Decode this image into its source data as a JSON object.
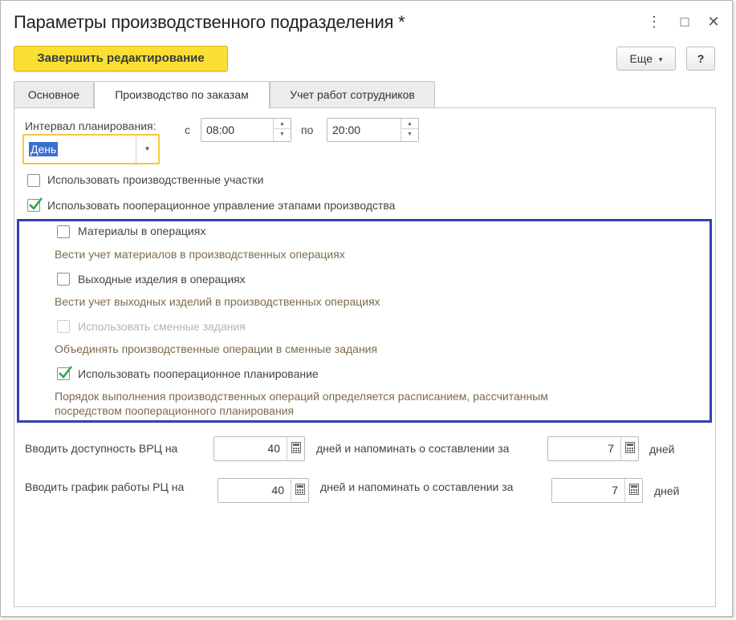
{
  "window": {
    "title": "Параметры производственного подразделения *",
    "controls": {
      "menu": "⋮",
      "maximize": "□",
      "close": "✕"
    }
  },
  "toolbar": {
    "finish_label": "Завершить редактирование",
    "more_label": "Еще",
    "more_arrow": "▾",
    "help_label": "?"
  },
  "tabs": [
    {
      "label": "Основное",
      "active": false
    },
    {
      "label": "Производство по заказам",
      "active": true
    },
    {
      "label": "Учет работ сотрудников",
      "active": false
    }
  ],
  "planning": {
    "interval_label": "Интервал планирования:",
    "interval_value": "День",
    "from_label": "с",
    "from_value": "08:00",
    "to_label": "по",
    "to_value": "20:00"
  },
  "options": {
    "use_sections": {
      "label": "Использовать производственные участки",
      "checked": false
    },
    "use_operations": {
      "label": "Использовать пооперационное управление этапами производства",
      "checked": true
    }
  },
  "operations_group": {
    "materials": {
      "label": "Материалы в операциях",
      "checked": false,
      "hint": "Вести учет материалов в производственных операциях"
    },
    "outputs": {
      "label": "Выходные изделия в операциях",
      "checked": false,
      "hint": "Вести учет выходных изделий в производственных операциях"
    },
    "shift_tasks": {
      "label": "Использовать сменные задания",
      "checked": false,
      "disabled": true,
      "hint": "Объединять производственные операции в сменные задания"
    },
    "op_planning": {
      "label": "Использовать пооперационное планирование",
      "checked": true,
      "hint_line1": "Порядок выполнения производственных операций определяется расписанием, рассчитанным",
      "hint_line2": "посредством пооперационного планирования"
    }
  },
  "availability": {
    "vrc_label": "Вводить доступность ВРЦ на",
    "vrc_days": "40",
    "vrc_remind_label": "дней и напоминать о составлении за",
    "vrc_remind_days": "7",
    "vrc_days_suffix": "дней",
    "rc_label": "Вводить график работы РЦ на",
    "rc_days": "40",
    "rc_remind_label": "дней и напоминать о составлении за",
    "rc_remind_days": "7",
    "rc_days_suffix": "дней"
  },
  "colors": {
    "accent": "#fbdf34",
    "group_border": "#3241b5",
    "check": "#3aa34b",
    "hint": "#7d6a4c"
  }
}
